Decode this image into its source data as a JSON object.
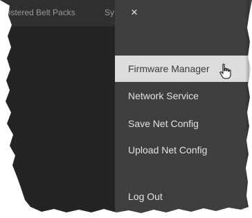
{
  "tabs": {
    "first": "gistered Belt Packs",
    "second": "Sy"
  },
  "menu": {
    "close_icon": "×",
    "items": [
      {
        "label": "Firmware Manager",
        "highlighted": true
      },
      {
        "label": "Network Service",
        "highlighted": false
      },
      {
        "label": "Save Net Config",
        "highlighted": false
      },
      {
        "label": "Upload Net Config",
        "highlighted": false
      },
      {
        "label": "Log Out",
        "highlighted": false
      }
    ]
  },
  "colors": {
    "left_panel": "#242424",
    "menu_panel": "#3f3f3f",
    "highlight": "#dcdcdc",
    "menu_text": "#e2e2e2"
  },
  "icons": {
    "close": "close-icon",
    "pointer": "hand-pointer-icon"
  }
}
